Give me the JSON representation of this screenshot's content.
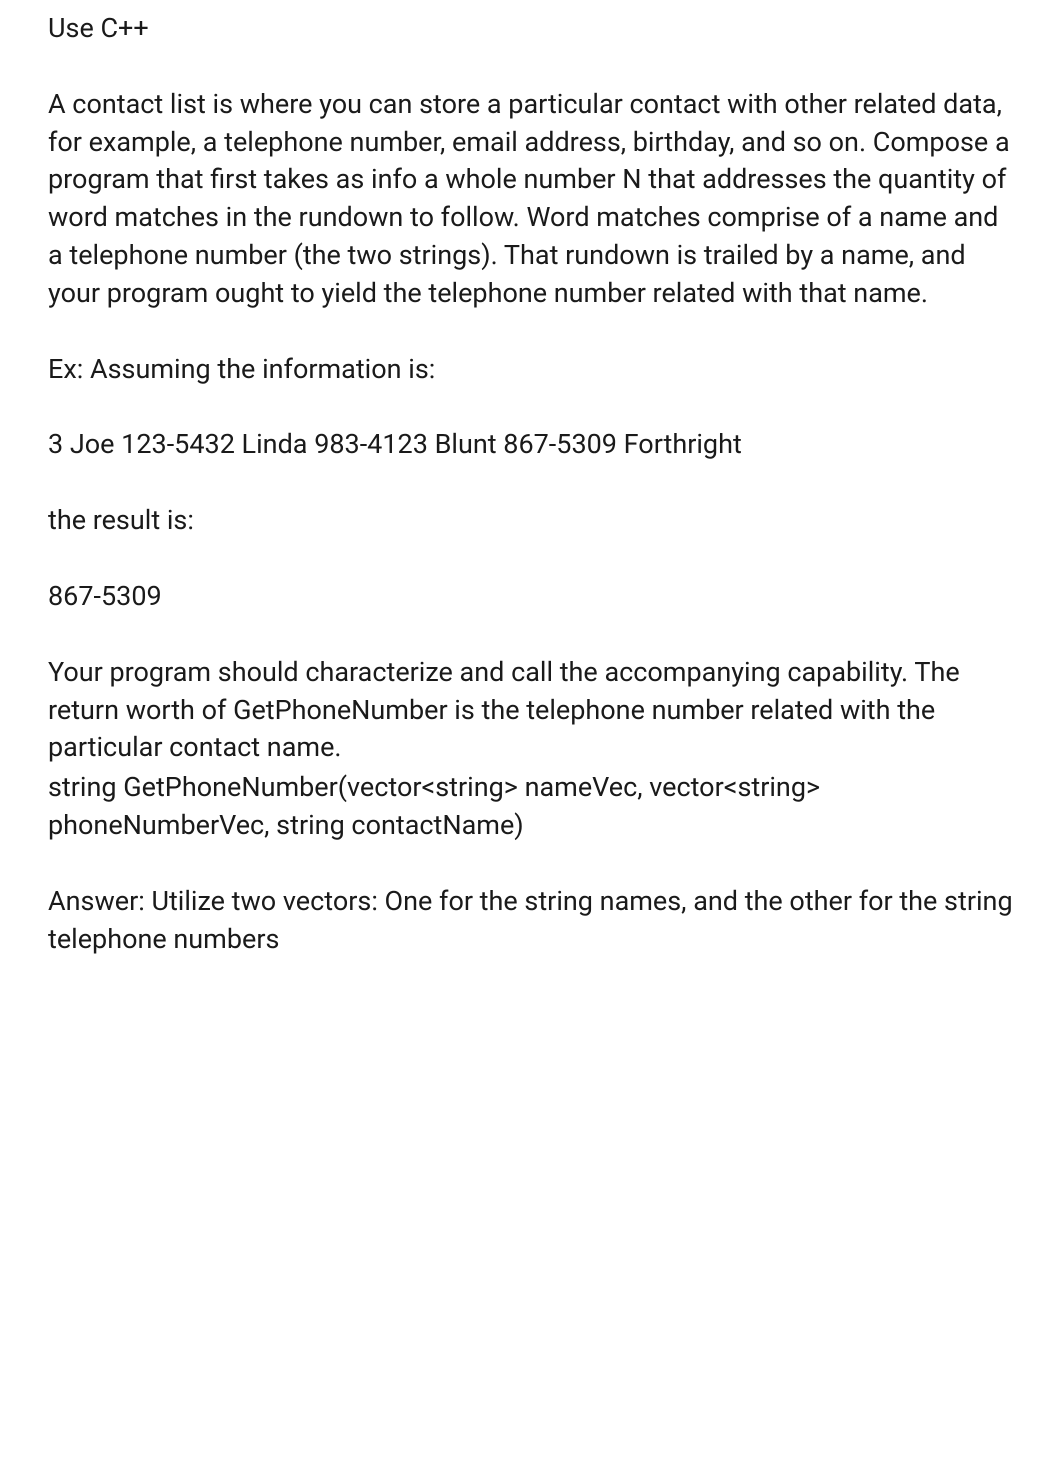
{
  "paragraphs": {
    "p1": "Use C++",
    "p2": "A contact list is where you can store a particular contact with other related data, for example, a telephone number, email address, birthday, and so on. Compose a program that first takes as info a whole number N that addresses the quantity of word matches in the rundown to follow. Word matches comprise of a name and a telephone number (the two strings). That rundown is trailed by a name, and your program ought to yield the telephone number related with that name.",
    "p3": "Ex: Assuming the information is:",
    "p4": "3 Joe 123-5432 Linda 983-4123 Blunt 867-5309 Forthright",
    "p5": "the result is:",
    "p6": "867-5309",
    "p7a": "Your program should characterize and call the accompanying capability. The return worth of GetPhoneNumber is the telephone number related with the particular contact name.",
    "p7b": "string GetPhoneNumber(vector<string> nameVec, vector<string> phoneNumberVec, string contactName)",
    "p8": "Answer: Utilize two vectors: One for the string names, and the other for the string telephone numbers"
  }
}
